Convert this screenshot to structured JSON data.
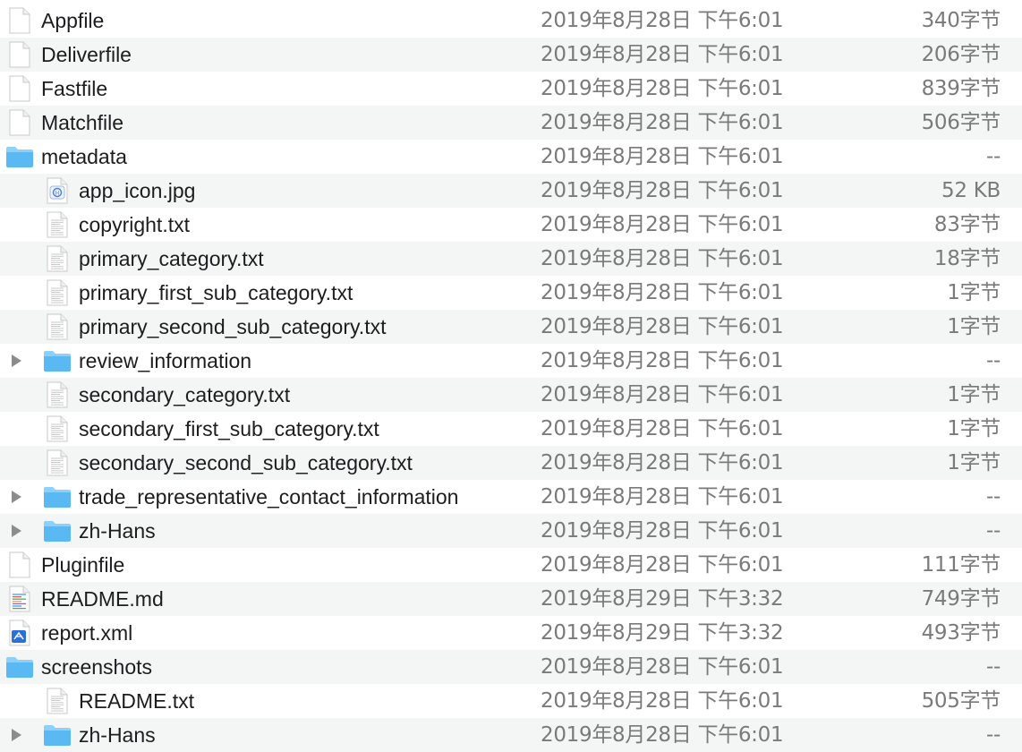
{
  "colors": {
    "folder": "#5ab8f3",
    "folder_tab": "#8fd0fa",
    "row_alt": "#f4f5f5",
    "meta_text": "#7a7a7a",
    "disclosure": "#8c8c8c"
  },
  "rows": [
    {
      "name": "Appfile",
      "date": "2019年8月28日 下午6:01",
      "size": "340字节",
      "level": 0,
      "kind": "file",
      "icon": "document-icon",
      "expandable": false
    },
    {
      "name": "Deliverfile",
      "date": "2019年8月28日 下午6:01",
      "size": "206字节",
      "level": 0,
      "kind": "file",
      "icon": "document-icon",
      "expandable": false
    },
    {
      "name": "Fastfile",
      "date": "2019年8月28日 下午6:01",
      "size": "839字节",
      "level": 0,
      "kind": "file",
      "icon": "document-icon",
      "expandable": false
    },
    {
      "name": "Matchfile",
      "date": "2019年8月28日 下午6:01",
      "size": "506字节",
      "level": 0,
      "kind": "file",
      "icon": "document-icon",
      "expandable": false
    },
    {
      "name": "metadata",
      "date": "2019年8月28日 下午6:01",
      "size": "--",
      "level": 0,
      "kind": "folder",
      "icon": "folder-icon",
      "expandable": false
    },
    {
      "name": "app_icon.jpg",
      "date": "2019年8月28日 下午6:01",
      "size": "52 KB",
      "level": 1,
      "kind": "image",
      "icon": "image-file-icon",
      "expandable": false
    },
    {
      "name": "copyright.txt",
      "date": "2019年8月28日 下午6:01",
      "size": "83字节",
      "level": 1,
      "kind": "text",
      "icon": "text-file-icon",
      "expandable": false
    },
    {
      "name": "primary_category.txt",
      "date": "2019年8月28日 下午6:01",
      "size": "18字节",
      "level": 1,
      "kind": "text",
      "icon": "text-file-icon",
      "expandable": false
    },
    {
      "name": "primary_first_sub_category.txt",
      "date": "2019年8月28日 下午6:01",
      "size": "1字节",
      "level": 1,
      "kind": "text",
      "icon": "text-file-icon",
      "expandable": false
    },
    {
      "name": "primary_second_sub_category.txt",
      "date": "2019年8月28日 下午6:01",
      "size": "1字节",
      "level": 1,
      "kind": "text",
      "icon": "text-file-icon",
      "expandable": false
    },
    {
      "name": "review_information",
      "date": "2019年8月28日 下午6:01",
      "size": "--",
      "level": 1,
      "kind": "folder",
      "icon": "folder-icon",
      "expandable": true
    },
    {
      "name": "secondary_category.txt",
      "date": "2019年8月28日 下午6:01",
      "size": "1字节",
      "level": 1,
      "kind": "text",
      "icon": "text-file-icon",
      "expandable": false
    },
    {
      "name": "secondary_first_sub_category.txt",
      "date": "2019年8月28日 下午6:01",
      "size": "1字节",
      "level": 1,
      "kind": "text",
      "icon": "text-file-icon",
      "expandable": false
    },
    {
      "name": "secondary_second_sub_category.txt",
      "date": "2019年8月28日 下午6:01",
      "size": "1字节",
      "level": 1,
      "kind": "text",
      "icon": "text-file-icon",
      "expandable": false
    },
    {
      "name": "trade_representative_contact_information",
      "date": "2019年8月28日 下午6:01",
      "size": "--",
      "level": 1,
      "kind": "folder",
      "icon": "folder-icon",
      "expandable": true
    },
    {
      "name": "zh-Hans",
      "date": "2019年8月28日 下午6:01",
      "size": "--",
      "level": 1,
      "kind": "folder",
      "icon": "folder-icon",
      "expandable": true
    },
    {
      "name": "Pluginfile",
      "date": "2019年8月28日 下午6:01",
      "size": "111字节",
      "level": 0,
      "kind": "file",
      "icon": "document-icon",
      "expandable": false
    },
    {
      "name": "README.md",
      "date": "2019年8月29日 下午3:32",
      "size": "749字节",
      "level": 0,
      "kind": "markdown",
      "icon": "markdown-file-icon",
      "expandable": false
    },
    {
      "name": "report.xml",
      "date": "2019年8月29日 下午3:32",
      "size": "493字节",
      "level": 0,
      "kind": "xml",
      "icon": "xml-file-icon",
      "expandable": false
    },
    {
      "name": "screenshots",
      "date": "2019年8月28日 下午6:01",
      "size": "--",
      "level": 0,
      "kind": "folder",
      "icon": "folder-icon",
      "expandable": false
    },
    {
      "name": "README.txt",
      "date": "2019年8月28日 下午6:01",
      "size": "505字节",
      "level": 1,
      "kind": "text",
      "icon": "text-file-icon",
      "expandable": false
    },
    {
      "name": "zh-Hans",
      "date": "2019年8月28日 下午6:01",
      "size": "--",
      "level": 1,
      "kind": "folder",
      "icon": "folder-icon",
      "expandable": true
    }
  ]
}
